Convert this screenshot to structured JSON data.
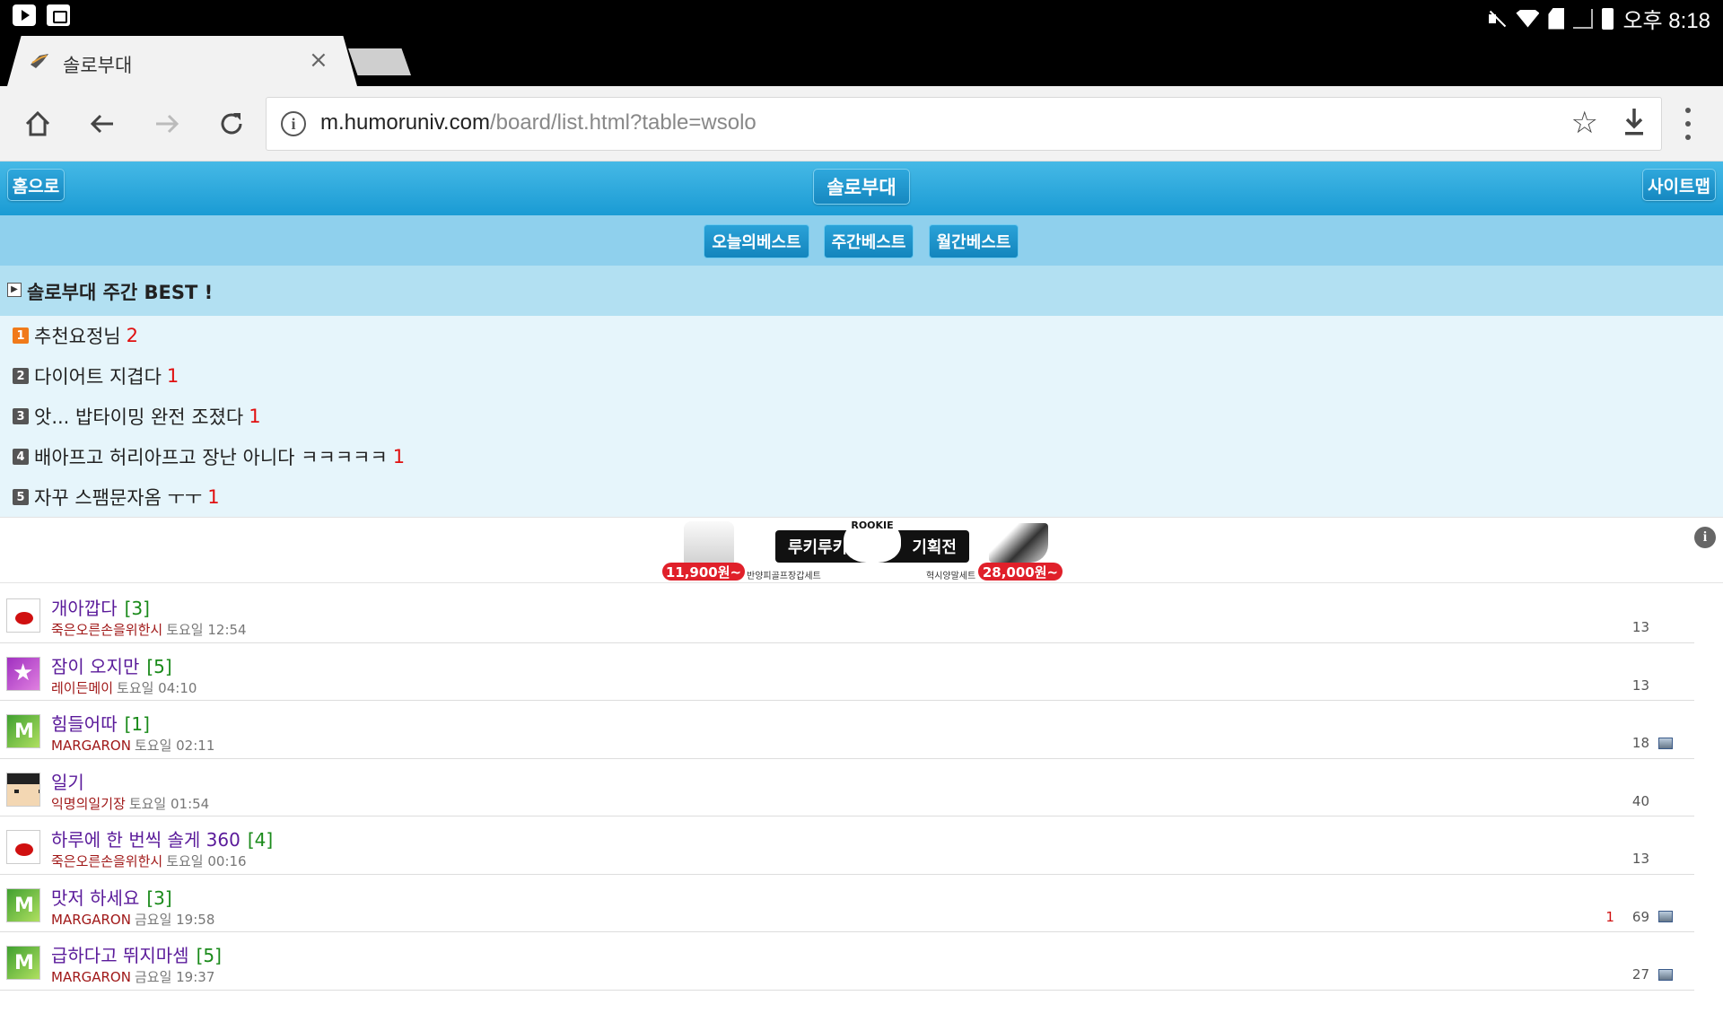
{
  "status_bar": {
    "time": "오후 8:18"
  },
  "browser": {
    "tab_title": "솔로부대",
    "tab_close": "×",
    "url_host": "m.humoruniv.com",
    "url_path": "/board/list.html?table=wsolo"
  },
  "site": {
    "home_button": "홈으로",
    "title_button": "솔로부대",
    "sitemap_button": "사이트맵",
    "nav": [
      "오늘의베스트",
      "주간베스트",
      "월간베스트"
    ]
  },
  "best": {
    "heading": "솔로부대 주간 BEST !",
    "items": [
      {
        "num": "1",
        "title": "추천요정님",
        "count": "2"
      },
      {
        "num": "2",
        "title": "다이어트 지겹다",
        "count": "1"
      },
      {
        "num": "3",
        "title": "앗... 밥타이밍 완전 조졌다",
        "count": "1"
      },
      {
        "num": "4",
        "title": "배아프고 허리아프고 장난 아니다 ㅋㅋㅋㅋㅋ",
        "count": "1"
      },
      {
        "num": "5",
        "title": "자꾸 스팸문자옴 ㅜㅜ",
        "count": "1"
      }
    ]
  },
  "ad": {
    "price_left": "11,900원~",
    "caption_left": "반양피골프장갑세트",
    "label_left": "루키루키",
    "badge": "ROOKIE",
    "label_right": "기획전",
    "caption_right": "혁시양말세트",
    "price_right": "28,000원~",
    "info": "i"
  },
  "posts": [
    {
      "title": "개아깝다",
      "comments": "[3]",
      "author": "죽은오른손을위한시",
      "date": "토요일 12:54",
      "recommend": "",
      "views": "13",
      "has_image": false,
      "avatar": "bird"
    },
    {
      "title": "잠이 오지만",
      "comments": "[5]",
      "author": "레이든메이",
      "date": "토요일 04:10",
      "recommend": "",
      "views": "13",
      "has_image": false,
      "avatar": "star"
    },
    {
      "title": "힘들어따",
      "comments": "[1]",
      "author": "MARGARON",
      "date": "토요일 02:11",
      "recommend": "",
      "views": "18",
      "has_image": true,
      "avatar": "m"
    },
    {
      "title": "일기",
      "comments": "",
      "author": "익명의일기장",
      "date": "토요일 01:54",
      "recommend": "",
      "views": "40",
      "has_image": false,
      "avatar": "face"
    },
    {
      "title": "하루에 한 번씩 솔게 360",
      "comments": "[4]",
      "author": "죽은오른손을위한시",
      "date": "토요일 00:16",
      "recommend": "",
      "views": "13",
      "has_image": false,
      "avatar": "bird"
    },
    {
      "title": "맛저 하세요",
      "comments": "[3]",
      "author": "MARGARON",
      "date": "금요일 19:58",
      "recommend": "1",
      "views": "69",
      "has_image": true,
      "avatar": "m"
    },
    {
      "title": "급하다고 뛰지마셈",
      "comments": "[5]",
      "author": "MARGARON",
      "date": "금요일 19:37",
      "recommend": "",
      "views": "27",
      "has_image": true,
      "avatar": "m"
    }
  ]
}
